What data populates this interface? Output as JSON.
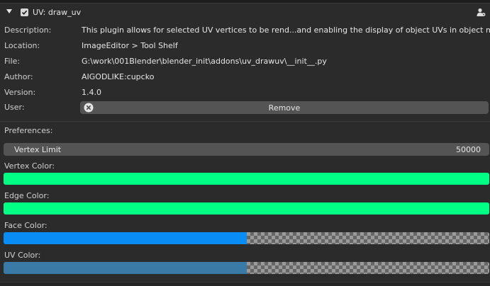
{
  "addon": {
    "title": "UV: draw_uv",
    "enabled": true
  },
  "info": [
    {
      "label": "Description:",
      "value": "This plugin allows for selected UV vertices to be rend...and enabling the display of object UVs in object mode."
    },
    {
      "label": "Location:",
      "value": "ImageEditor > Tool Shelf"
    },
    {
      "label": "File:",
      "value": "G:\\work\\001Blender\\blender_init\\addons\\uv_drawuv\\__init__.py"
    },
    {
      "label": "Author:",
      "value": "AIGODLIKE:cupcko"
    },
    {
      "label": "Version:",
      "value": "1.4.0"
    }
  ],
  "user": {
    "label": "User:",
    "remove_label": "Remove"
  },
  "preferences": {
    "label": "Preferences:",
    "vertex_limit": {
      "label": "Vertex Limit",
      "value": "50000"
    },
    "colors": [
      {
        "label": "Vertex Color:",
        "color": "#00ff84",
        "alpha": 1.0
      },
      {
        "label": "Edge Color:",
        "color": "#00ff84",
        "alpha": 1.0
      },
      {
        "label": "Face Color:",
        "color": "#0a8cf5",
        "alpha": 0.5
      },
      {
        "label": "UV Color:",
        "color": "#3a7aa6",
        "alpha": 0.5
      }
    ]
  },
  "icons": {
    "disclosure": "triangle-down-icon",
    "checkbox": "checkbox-checked-icon",
    "user": "user-icon",
    "remove": "x-circle-icon"
  }
}
